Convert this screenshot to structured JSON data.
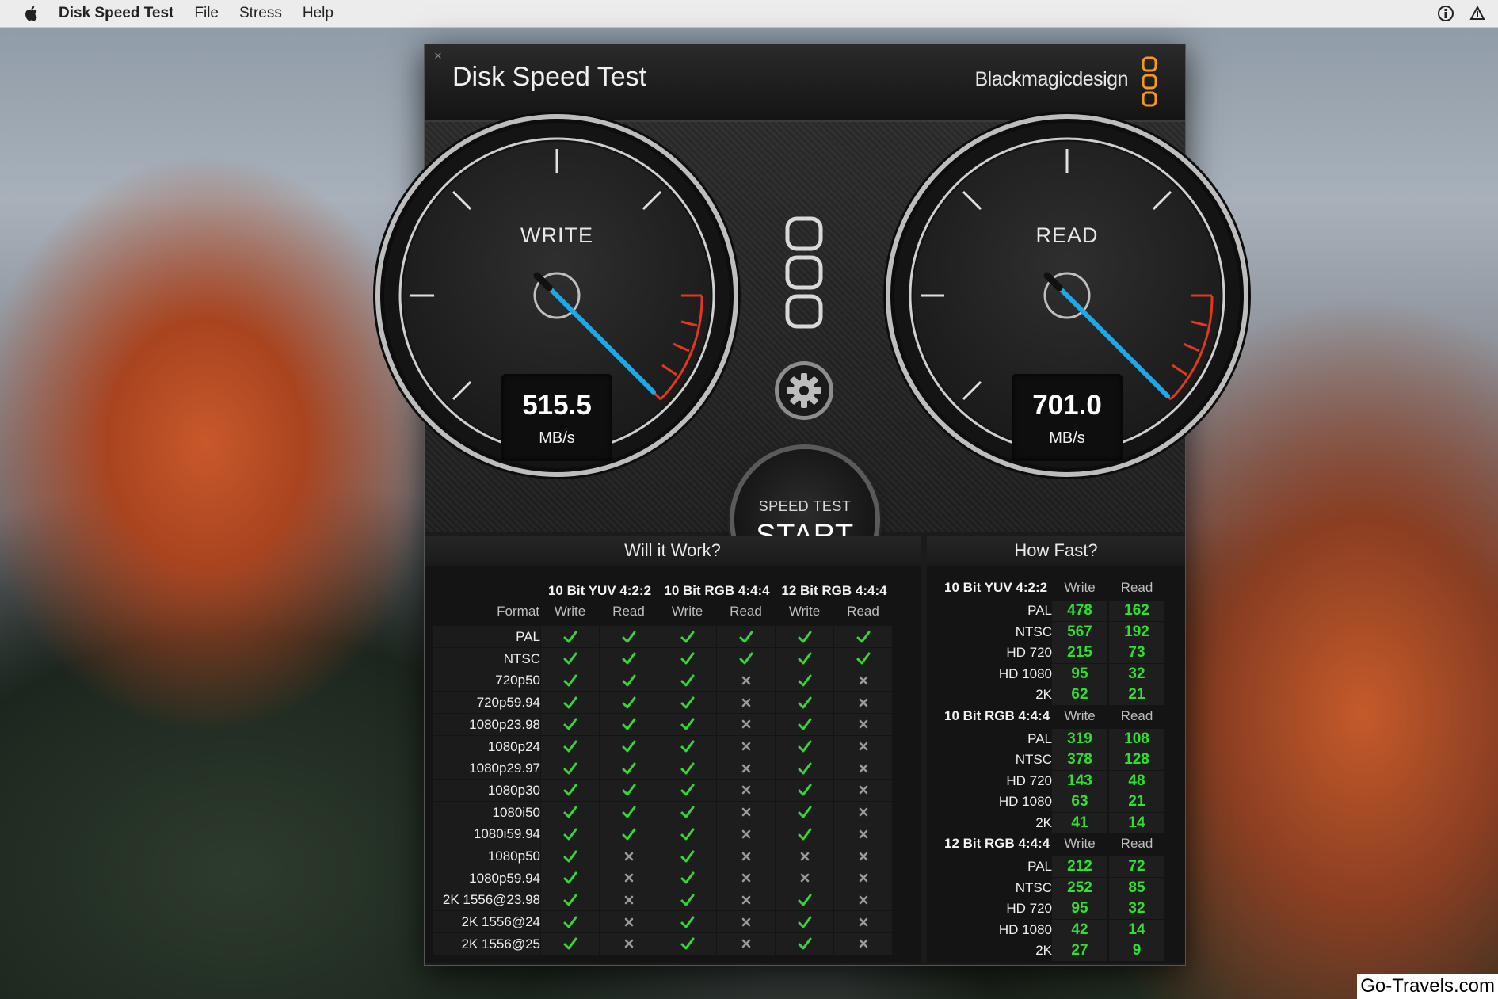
{
  "menubar": {
    "app_name": "Disk Speed Test",
    "items": [
      "File",
      "Stress",
      "Help"
    ],
    "icons": [
      "apple-icon",
      "info-icon",
      "upload-icon"
    ]
  },
  "window": {
    "title": "Disk Speed Test",
    "brand": "Blackmagicdesign"
  },
  "gauges": {
    "write": {
      "label": "WRITE",
      "value": "515.5",
      "unit": "MB/s"
    },
    "read": {
      "label": "READ",
      "value": "701.0",
      "unit": "MB/s"
    }
  },
  "start_button": {
    "small": "SPEED TEST",
    "big": "START"
  },
  "will_it_work": {
    "title": "Will it Work?",
    "format_header": "Format",
    "groups": [
      "10 Bit YUV 4:2:2",
      "10 Bit RGB 4:4:4",
      "12 Bit RGB 4:4:4"
    ],
    "subcols": [
      "Write",
      "Read",
      "Write",
      "Read",
      "Write",
      "Read"
    ],
    "rows": [
      {
        "format": "PAL",
        "cells": [
          1,
          1,
          1,
          1,
          1,
          1
        ]
      },
      {
        "format": "NTSC",
        "cells": [
          1,
          1,
          1,
          1,
          1,
          1
        ]
      },
      {
        "format": "720p50",
        "cells": [
          1,
          1,
          1,
          0,
          1,
          0
        ]
      },
      {
        "format": "720p59.94",
        "cells": [
          1,
          1,
          1,
          0,
          1,
          0
        ]
      },
      {
        "format": "1080p23.98",
        "cells": [
          1,
          1,
          1,
          0,
          1,
          0
        ]
      },
      {
        "format": "1080p24",
        "cells": [
          1,
          1,
          1,
          0,
          1,
          0
        ]
      },
      {
        "format": "1080p29.97",
        "cells": [
          1,
          1,
          1,
          0,
          1,
          0
        ]
      },
      {
        "format": "1080p30",
        "cells": [
          1,
          1,
          1,
          0,
          1,
          0
        ]
      },
      {
        "format": "1080i50",
        "cells": [
          1,
          1,
          1,
          0,
          1,
          0
        ]
      },
      {
        "format": "1080i59.94",
        "cells": [
          1,
          1,
          1,
          0,
          1,
          0
        ]
      },
      {
        "format": "1080p50",
        "cells": [
          1,
          0,
          1,
          0,
          0,
          0
        ]
      },
      {
        "format": "1080p59.94",
        "cells": [
          1,
          0,
          1,
          0,
          0,
          0
        ]
      },
      {
        "format": "2K 1556@23.98",
        "cells": [
          1,
          0,
          1,
          0,
          1,
          0
        ]
      },
      {
        "format": "2K 1556@24",
        "cells": [
          1,
          0,
          1,
          0,
          1,
          0
        ]
      },
      {
        "format": "2K 1556@25",
        "cells": [
          1,
          0,
          1,
          0,
          1,
          0
        ]
      }
    ]
  },
  "how_fast": {
    "title": "How Fast?",
    "col_write": "Write",
    "col_read": "Read",
    "groups": [
      {
        "name": "10 Bit YUV 4:2:2",
        "rows": [
          {
            "format": "PAL",
            "write": "478",
            "read": "162"
          },
          {
            "format": "NTSC",
            "write": "567",
            "read": "192"
          },
          {
            "format": "HD 720",
            "write": "215",
            "read": "73"
          },
          {
            "format": "HD 1080",
            "write": "95",
            "read": "32"
          },
          {
            "format": "2K",
            "write": "62",
            "read": "21"
          }
        ]
      },
      {
        "name": "10 Bit RGB 4:4:4",
        "rows": [
          {
            "format": "PAL",
            "write": "319",
            "read": "108"
          },
          {
            "format": "NTSC",
            "write": "378",
            "read": "128"
          },
          {
            "format": "HD 720",
            "write": "143",
            "read": "48"
          },
          {
            "format": "HD 1080",
            "write": "63",
            "read": "21"
          },
          {
            "format": "2K",
            "write": "41",
            "read": "14"
          }
        ]
      },
      {
        "name": "12 Bit RGB 4:4:4",
        "rows": [
          {
            "format": "PAL",
            "write": "212",
            "read": "72"
          },
          {
            "format": "NTSC",
            "write": "252",
            "read": "85"
          },
          {
            "format": "HD 720",
            "write": "95",
            "read": "32"
          },
          {
            "format": "HD 1080",
            "write": "42",
            "read": "14"
          },
          {
            "format": "2K",
            "write": "27",
            "read": "9"
          }
        ]
      }
    ]
  },
  "watermark": "Go-Travels.com",
  "colors": {
    "check": "#36d636",
    "cross": "#9a9a9a",
    "needle": "#1fa8e6",
    "redline": "#e0391f",
    "value_green": "#2fe02f"
  }
}
